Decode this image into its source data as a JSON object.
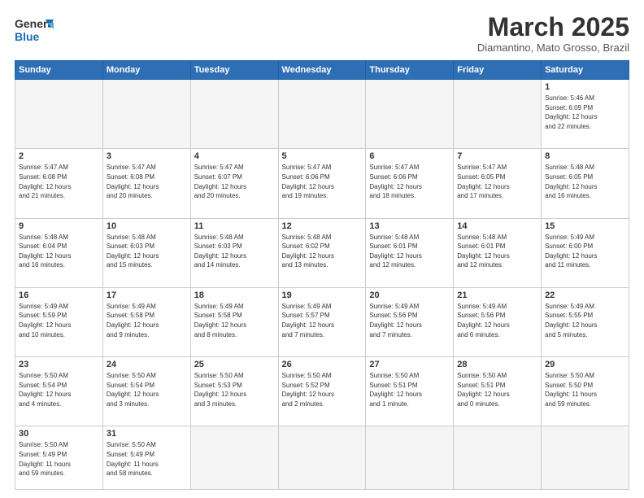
{
  "header": {
    "logo_general": "General",
    "logo_blue": "Blue",
    "month_title": "March 2025",
    "subtitle": "Diamantino, Mato Grosso, Brazil"
  },
  "weekdays": [
    "Sunday",
    "Monday",
    "Tuesday",
    "Wednesday",
    "Thursday",
    "Friday",
    "Saturday"
  ],
  "weeks": [
    [
      {
        "day": "",
        "info": ""
      },
      {
        "day": "",
        "info": ""
      },
      {
        "day": "",
        "info": ""
      },
      {
        "day": "",
        "info": ""
      },
      {
        "day": "",
        "info": ""
      },
      {
        "day": "",
        "info": ""
      },
      {
        "day": "1",
        "info": "Sunrise: 5:46 AM\nSunset: 6:09 PM\nDaylight: 12 hours\nand 22 minutes."
      }
    ],
    [
      {
        "day": "2",
        "info": "Sunrise: 5:47 AM\nSunset: 6:08 PM\nDaylight: 12 hours\nand 21 minutes."
      },
      {
        "day": "3",
        "info": "Sunrise: 5:47 AM\nSunset: 6:08 PM\nDaylight: 12 hours\nand 20 minutes."
      },
      {
        "day": "4",
        "info": "Sunrise: 5:47 AM\nSunset: 6:07 PM\nDaylight: 12 hours\nand 20 minutes."
      },
      {
        "day": "5",
        "info": "Sunrise: 5:47 AM\nSunset: 6:06 PM\nDaylight: 12 hours\nand 19 minutes."
      },
      {
        "day": "6",
        "info": "Sunrise: 5:47 AM\nSunset: 6:06 PM\nDaylight: 12 hours\nand 18 minutes."
      },
      {
        "day": "7",
        "info": "Sunrise: 5:47 AM\nSunset: 6:05 PM\nDaylight: 12 hours\nand 17 minutes."
      },
      {
        "day": "8",
        "info": "Sunrise: 5:48 AM\nSunset: 6:05 PM\nDaylight: 12 hours\nand 16 minutes."
      }
    ],
    [
      {
        "day": "9",
        "info": "Sunrise: 5:48 AM\nSunset: 6:04 PM\nDaylight: 12 hours\nand 16 minutes."
      },
      {
        "day": "10",
        "info": "Sunrise: 5:48 AM\nSunset: 6:03 PM\nDaylight: 12 hours\nand 15 minutes."
      },
      {
        "day": "11",
        "info": "Sunrise: 5:48 AM\nSunset: 6:03 PM\nDaylight: 12 hours\nand 14 minutes."
      },
      {
        "day": "12",
        "info": "Sunrise: 5:48 AM\nSunset: 6:02 PM\nDaylight: 12 hours\nand 13 minutes."
      },
      {
        "day": "13",
        "info": "Sunrise: 5:48 AM\nSunset: 6:01 PM\nDaylight: 12 hours\nand 12 minutes."
      },
      {
        "day": "14",
        "info": "Sunrise: 5:48 AM\nSunset: 6:01 PM\nDaylight: 12 hours\nand 12 minutes."
      },
      {
        "day": "15",
        "info": "Sunrise: 5:49 AM\nSunset: 6:00 PM\nDaylight: 12 hours\nand 11 minutes."
      }
    ],
    [
      {
        "day": "16",
        "info": "Sunrise: 5:49 AM\nSunset: 5:59 PM\nDaylight: 12 hours\nand 10 minutes."
      },
      {
        "day": "17",
        "info": "Sunrise: 5:49 AM\nSunset: 5:58 PM\nDaylight: 12 hours\nand 9 minutes."
      },
      {
        "day": "18",
        "info": "Sunrise: 5:49 AM\nSunset: 5:58 PM\nDaylight: 12 hours\nand 8 minutes."
      },
      {
        "day": "19",
        "info": "Sunrise: 5:49 AM\nSunset: 5:57 PM\nDaylight: 12 hours\nand 7 minutes."
      },
      {
        "day": "20",
        "info": "Sunrise: 5:49 AM\nSunset: 5:56 PM\nDaylight: 12 hours\nand 7 minutes."
      },
      {
        "day": "21",
        "info": "Sunrise: 5:49 AM\nSunset: 5:56 PM\nDaylight: 12 hours\nand 6 minutes."
      },
      {
        "day": "22",
        "info": "Sunrise: 5:49 AM\nSunset: 5:55 PM\nDaylight: 12 hours\nand 5 minutes."
      }
    ],
    [
      {
        "day": "23",
        "info": "Sunrise: 5:50 AM\nSunset: 5:54 PM\nDaylight: 12 hours\nand 4 minutes."
      },
      {
        "day": "24",
        "info": "Sunrise: 5:50 AM\nSunset: 5:54 PM\nDaylight: 12 hours\nand 3 minutes."
      },
      {
        "day": "25",
        "info": "Sunrise: 5:50 AM\nSunset: 5:53 PM\nDaylight: 12 hours\nand 3 minutes."
      },
      {
        "day": "26",
        "info": "Sunrise: 5:50 AM\nSunset: 5:52 PM\nDaylight: 12 hours\nand 2 minutes."
      },
      {
        "day": "27",
        "info": "Sunrise: 5:50 AM\nSunset: 5:51 PM\nDaylight: 12 hours\nand 1 minute."
      },
      {
        "day": "28",
        "info": "Sunrise: 5:50 AM\nSunset: 5:51 PM\nDaylight: 12 hours\nand 0 minutes."
      },
      {
        "day": "29",
        "info": "Sunrise: 5:50 AM\nSunset: 5:50 PM\nDaylight: 11 hours\nand 59 minutes."
      }
    ],
    [
      {
        "day": "30",
        "info": "Sunrise: 5:50 AM\nSunset: 5:49 PM\nDaylight: 11 hours\nand 59 minutes."
      },
      {
        "day": "31",
        "info": "Sunrise: 5:50 AM\nSunset: 5:49 PM\nDaylight: 11 hours\nand 58 minutes."
      },
      {
        "day": "",
        "info": ""
      },
      {
        "day": "",
        "info": ""
      },
      {
        "day": "",
        "info": ""
      },
      {
        "day": "",
        "info": ""
      },
      {
        "day": "",
        "info": ""
      }
    ]
  ]
}
